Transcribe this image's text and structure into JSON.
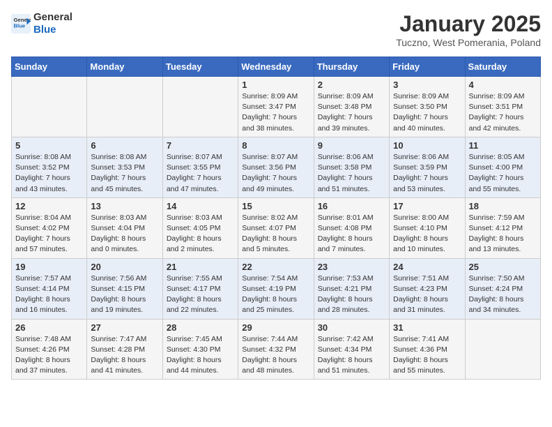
{
  "header": {
    "logo_general": "General",
    "logo_blue": "Blue",
    "title": "January 2025",
    "subtitle": "Tuczno, West Pomerania, Poland"
  },
  "weekdays": [
    "Sunday",
    "Monday",
    "Tuesday",
    "Wednesday",
    "Thursday",
    "Friday",
    "Saturday"
  ],
  "weeks": [
    [
      {
        "day": "",
        "info": ""
      },
      {
        "day": "",
        "info": ""
      },
      {
        "day": "",
        "info": ""
      },
      {
        "day": "1",
        "info": "Sunrise: 8:09 AM\nSunset: 3:47 PM\nDaylight: 7 hours\nand 38 minutes."
      },
      {
        "day": "2",
        "info": "Sunrise: 8:09 AM\nSunset: 3:48 PM\nDaylight: 7 hours\nand 39 minutes."
      },
      {
        "day": "3",
        "info": "Sunrise: 8:09 AM\nSunset: 3:50 PM\nDaylight: 7 hours\nand 40 minutes."
      },
      {
        "day": "4",
        "info": "Sunrise: 8:09 AM\nSunset: 3:51 PM\nDaylight: 7 hours\nand 42 minutes."
      }
    ],
    [
      {
        "day": "5",
        "info": "Sunrise: 8:08 AM\nSunset: 3:52 PM\nDaylight: 7 hours\nand 43 minutes."
      },
      {
        "day": "6",
        "info": "Sunrise: 8:08 AM\nSunset: 3:53 PM\nDaylight: 7 hours\nand 45 minutes."
      },
      {
        "day": "7",
        "info": "Sunrise: 8:07 AM\nSunset: 3:55 PM\nDaylight: 7 hours\nand 47 minutes."
      },
      {
        "day": "8",
        "info": "Sunrise: 8:07 AM\nSunset: 3:56 PM\nDaylight: 7 hours\nand 49 minutes."
      },
      {
        "day": "9",
        "info": "Sunrise: 8:06 AM\nSunset: 3:58 PM\nDaylight: 7 hours\nand 51 minutes."
      },
      {
        "day": "10",
        "info": "Sunrise: 8:06 AM\nSunset: 3:59 PM\nDaylight: 7 hours\nand 53 minutes."
      },
      {
        "day": "11",
        "info": "Sunrise: 8:05 AM\nSunset: 4:00 PM\nDaylight: 7 hours\nand 55 minutes."
      }
    ],
    [
      {
        "day": "12",
        "info": "Sunrise: 8:04 AM\nSunset: 4:02 PM\nDaylight: 7 hours\nand 57 minutes."
      },
      {
        "day": "13",
        "info": "Sunrise: 8:03 AM\nSunset: 4:04 PM\nDaylight: 8 hours\nand 0 minutes."
      },
      {
        "day": "14",
        "info": "Sunrise: 8:03 AM\nSunset: 4:05 PM\nDaylight: 8 hours\nand 2 minutes."
      },
      {
        "day": "15",
        "info": "Sunrise: 8:02 AM\nSunset: 4:07 PM\nDaylight: 8 hours\nand 5 minutes."
      },
      {
        "day": "16",
        "info": "Sunrise: 8:01 AM\nSunset: 4:08 PM\nDaylight: 8 hours\nand 7 minutes."
      },
      {
        "day": "17",
        "info": "Sunrise: 8:00 AM\nSunset: 4:10 PM\nDaylight: 8 hours\nand 10 minutes."
      },
      {
        "day": "18",
        "info": "Sunrise: 7:59 AM\nSunset: 4:12 PM\nDaylight: 8 hours\nand 13 minutes."
      }
    ],
    [
      {
        "day": "19",
        "info": "Sunrise: 7:57 AM\nSunset: 4:14 PM\nDaylight: 8 hours\nand 16 minutes."
      },
      {
        "day": "20",
        "info": "Sunrise: 7:56 AM\nSunset: 4:15 PM\nDaylight: 8 hours\nand 19 minutes."
      },
      {
        "day": "21",
        "info": "Sunrise: 7:55 AM\nSunset: 4:17 PM\nDaylight: 8 hours\nand 22 minutes."
      },
      {
        "day": "22",
        "info": "Sunrise: 7:54 AM\nSunset: 4:19 PM\nDaylight: 8 hours\nand 25 minutes."
      },
      {
        "day": "23",
        "info": "Sunrise: 7:53 AM\nSunset: 4:21 PM\nDaylight: 8 hours\nand 28 minutes."
      },
      {
        "day": "24",
        "info": "Sunrise: 7:51 AM\nSunset: 4:23 PM\nDaylight: 8 hours\nand 31 minutes."
      },
      {
        "day": "25",
        "info": "Sunrise: 7:50 AM\nSunset: 4:24 PM\nDaylight: 8 hours\nand 34 minutes."
      }
    ],
    [
      {
        "day": "26",
        "info": "Sunrise: 7:48 AM\nSunset: 4:26 PM\nDaylight: 8 hours\nand 37 minutes."
      },
      {
        "day": "27",
        "info": "Sunrise: 7:47 AM\nSunset: 4:28 PM\nDaylight: 8 hours\nand 41 minutes."
      },
      {
        "day": "28",
        "info": "Sunrise: 7:45 AM\nSunset: 4:30 PM\nDaylight: 8 hours\nand 44 minutes."
      },
      {
        "day": "29",
        "info": "Sunrise: 7:44 AM\nSunset: 4:32 PM\nDaylight: 8 hours\nand 48 minutes."
      },
      {
        "day": "30",
        "info": "Sunrise: 7:42 AM\nSunset: 4:34 PM\nDaylight: 8 hours\nand 51 minutes."
      },
      {
        "day": "31",
        "info": "Sunrise: 7:41 AM\nSunset: 4:36 PM\nDaylight: 8 hours\nand 55 minutes."
      },
      {
        "day": "",
        "info": ""
      }
    ]
  ]
}
